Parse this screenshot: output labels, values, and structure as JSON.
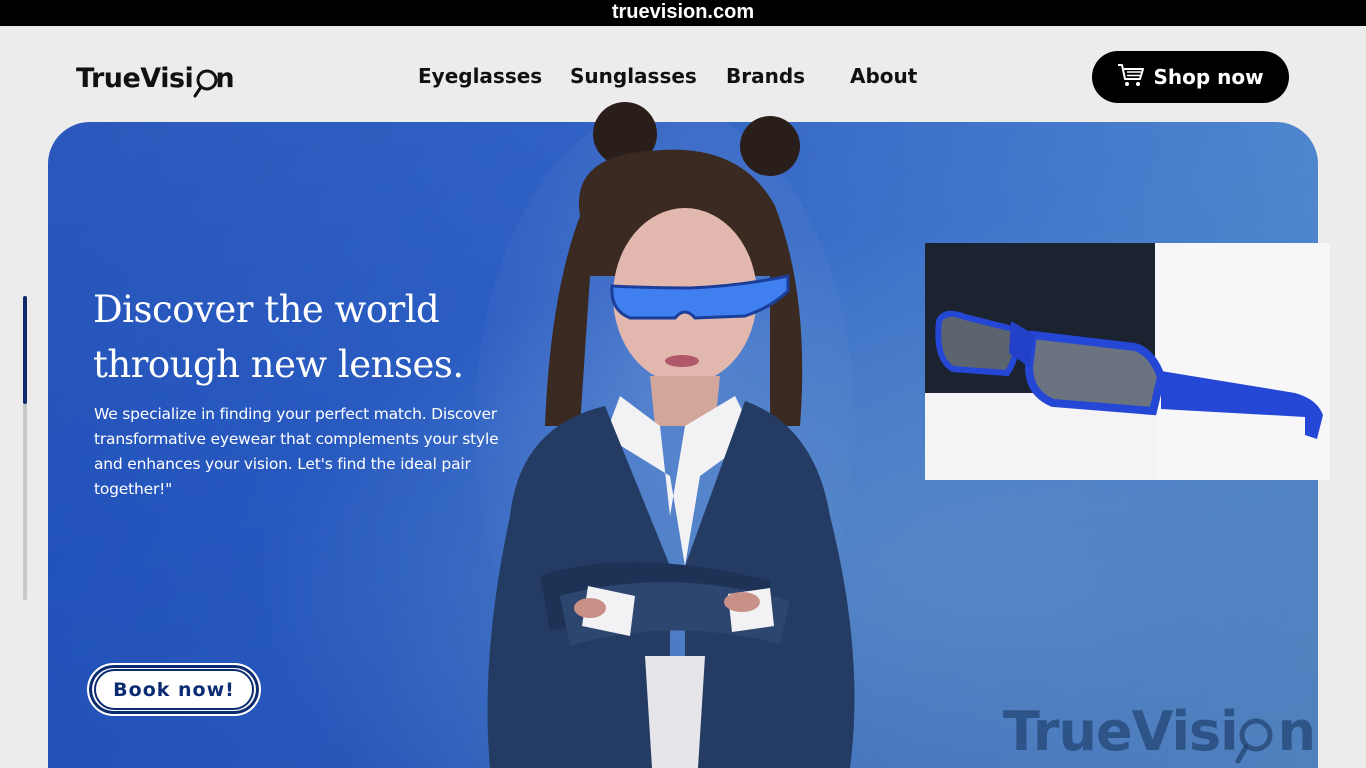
{
  "topbar": {
    "domain": "truevision.com"
  },
  "brand": {
    "logo_text_left": "TrueVisi",
    "logo_text_right": "n",
    "logo_alt": "TrueVision"
  },
  "nav": {
    "items": [
      "Eyeglasses",
      "Sunglasses",
      "Brands",
      "About"
    ]
  },
  "header": {
    "shop_label": "Shop now"
  },
  "hero": {
    "headline_line1": "Discover the world",
    "headline_line2": "through new lenses.",
    "description": "We specialize in finding your perfect match. Discover transformative eyewear that complements your style and enhances your vision. Let's find the ideal pair together!\"",
    "book_label": "Book now!",
    "watermark_left": "TrueVisi",
    "watermark_right": "n"
  },
  "colors": {
    "hero_blue": "#2a5cc2",
    "accent_navy": "#0c2c72",
    "topbar": "#000000"
  },
  "icons": [
    "cart-icon",
    "magnifier-icon"
  ]
}
